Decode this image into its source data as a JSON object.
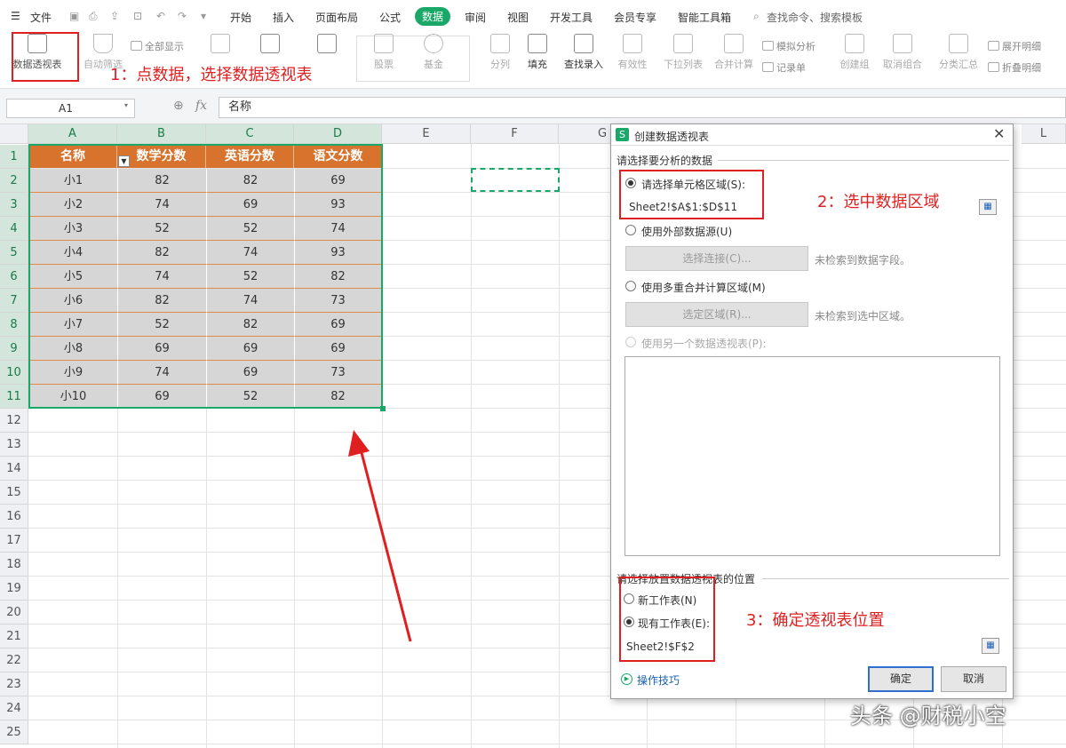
{
  "menubar": {
    "file_label": "文件",
    "tabs": [
      "开始",
      "插入",
      "页面布局",
      "公式",
      "数据",
      "审阅",
      "视图",
      "开发工具",
      "会员专享",
      "智能工具箱"
    ],
    "active_tab": "数据",
    "search_placeholder": "查找命令、搜索模板"
  },
  "toolbar": {
    "pivot": "数据透视表",
    "autofilter": "自动筛选",
    "show_all": "全部显示",
    "stocks": "股票",
    "fund": "基金",
    "split": "分列",
    "fill": "填充",
    "lookup": "查找录入",
    "validity": "有效性",
    "dropdown": "下拉列表",
    "consolidate": "合并计算",
    "simulate": "模拟分析",
    "record": "记录单",
    "create_group": "创建组",
    "ungroup": "取消组合",
    "subtotal": "分类汇总",
    "expand": "展开明细",
    "collapse": "折叠明细"
  },
  "formulabar": {
    "name_box": "A1",
    "formula_value": "名称"
  },
  "sheet": {
    "columns": [
      "A",
      "B",
      "C",
      "D",
      "E",
      "F",
      "G",
      "L"
    ],
    "rows": [
      "1",
      "2",
      "3",
      "4",
      "5",
      "6",
      "7",
      "8",
      "9",
      "10",
      "11",
      "12",
      "13",
      "14",
      "15",
      "16",
      "17",
      "18",
      "19",
      "20",
      "21",
      "22",
      "23",
      "24",
      "25"
    ],
    "headers": [
      "名称",
      "数学分数",
      "英语分数",
      "语文分数"
    ],
    "data": [
      [
        "小1",
        "82",
        "82",
        "69"
      ],
      [
        "小2",
        "74",
        "69",
        "93"
      ],
      [
        "小3",
        "52",
        "52",
        "74"
      ],
      [
        "小4",
        "82",
        "74",
        "93"
      ],
      [
        "小5",
        "74",
        "52",
        "82"
      ],
      [
        "小6",
        "82",
        "74",
        "73"
      ],
      [
        "小7",
        "52",
        "82",
        "69"
      ],
      [
        "小8",
        "69",
        "69",
        "69"
      ],
      [
        "小9",
        "74",
        "69",
        "73"
      ],
      [
        "小10",
        "69",
        "52",
        "82"
      ]
    ]
  },
  "dialog": {
    "title": "创建数据透视表",
    "section1": "请选择要分析的数据",
    "opt_range": "请选择单元格区域(S):",
    "range_value": "Sheet2!$A$1:$D$11",
    "opt_external": "使用外部数据源(U)",
    "btn_select_conn": "选择连接(C)...",
    "hint_conn": "未检索到数据字段。",
    "opt_multi": "使用多重合并计算区域(M)",
    "btn_select_region": "选定区域(R)...",
    "hint_region": "未检索到选中区域。",
    "opt_other": "使用另一个数据透视表(P):",
    "section2": "请选择放置数据透视表的位置",
    "opt_new": "新工作表(N)",
    "opt_existing": "现有工作表(E):",
    "location_value": "Sheet2!$F$2",
    "tips": "操作技巧",
    "ok": "确定",
    "cancel": "取消"
  },
  "annotations": {
    "step1": "1：点数据，选择数据透视表",
    "step2": "2：选中数据区域",
    "step3": "3：确定透视表位置"
  },
  "watermark": "头条 @财税小空",
  "colors": {
    "accent": "#1aa868",
    "header_orange": "#d7732d",
    "annotation_red": "#e02020"
  }
}
